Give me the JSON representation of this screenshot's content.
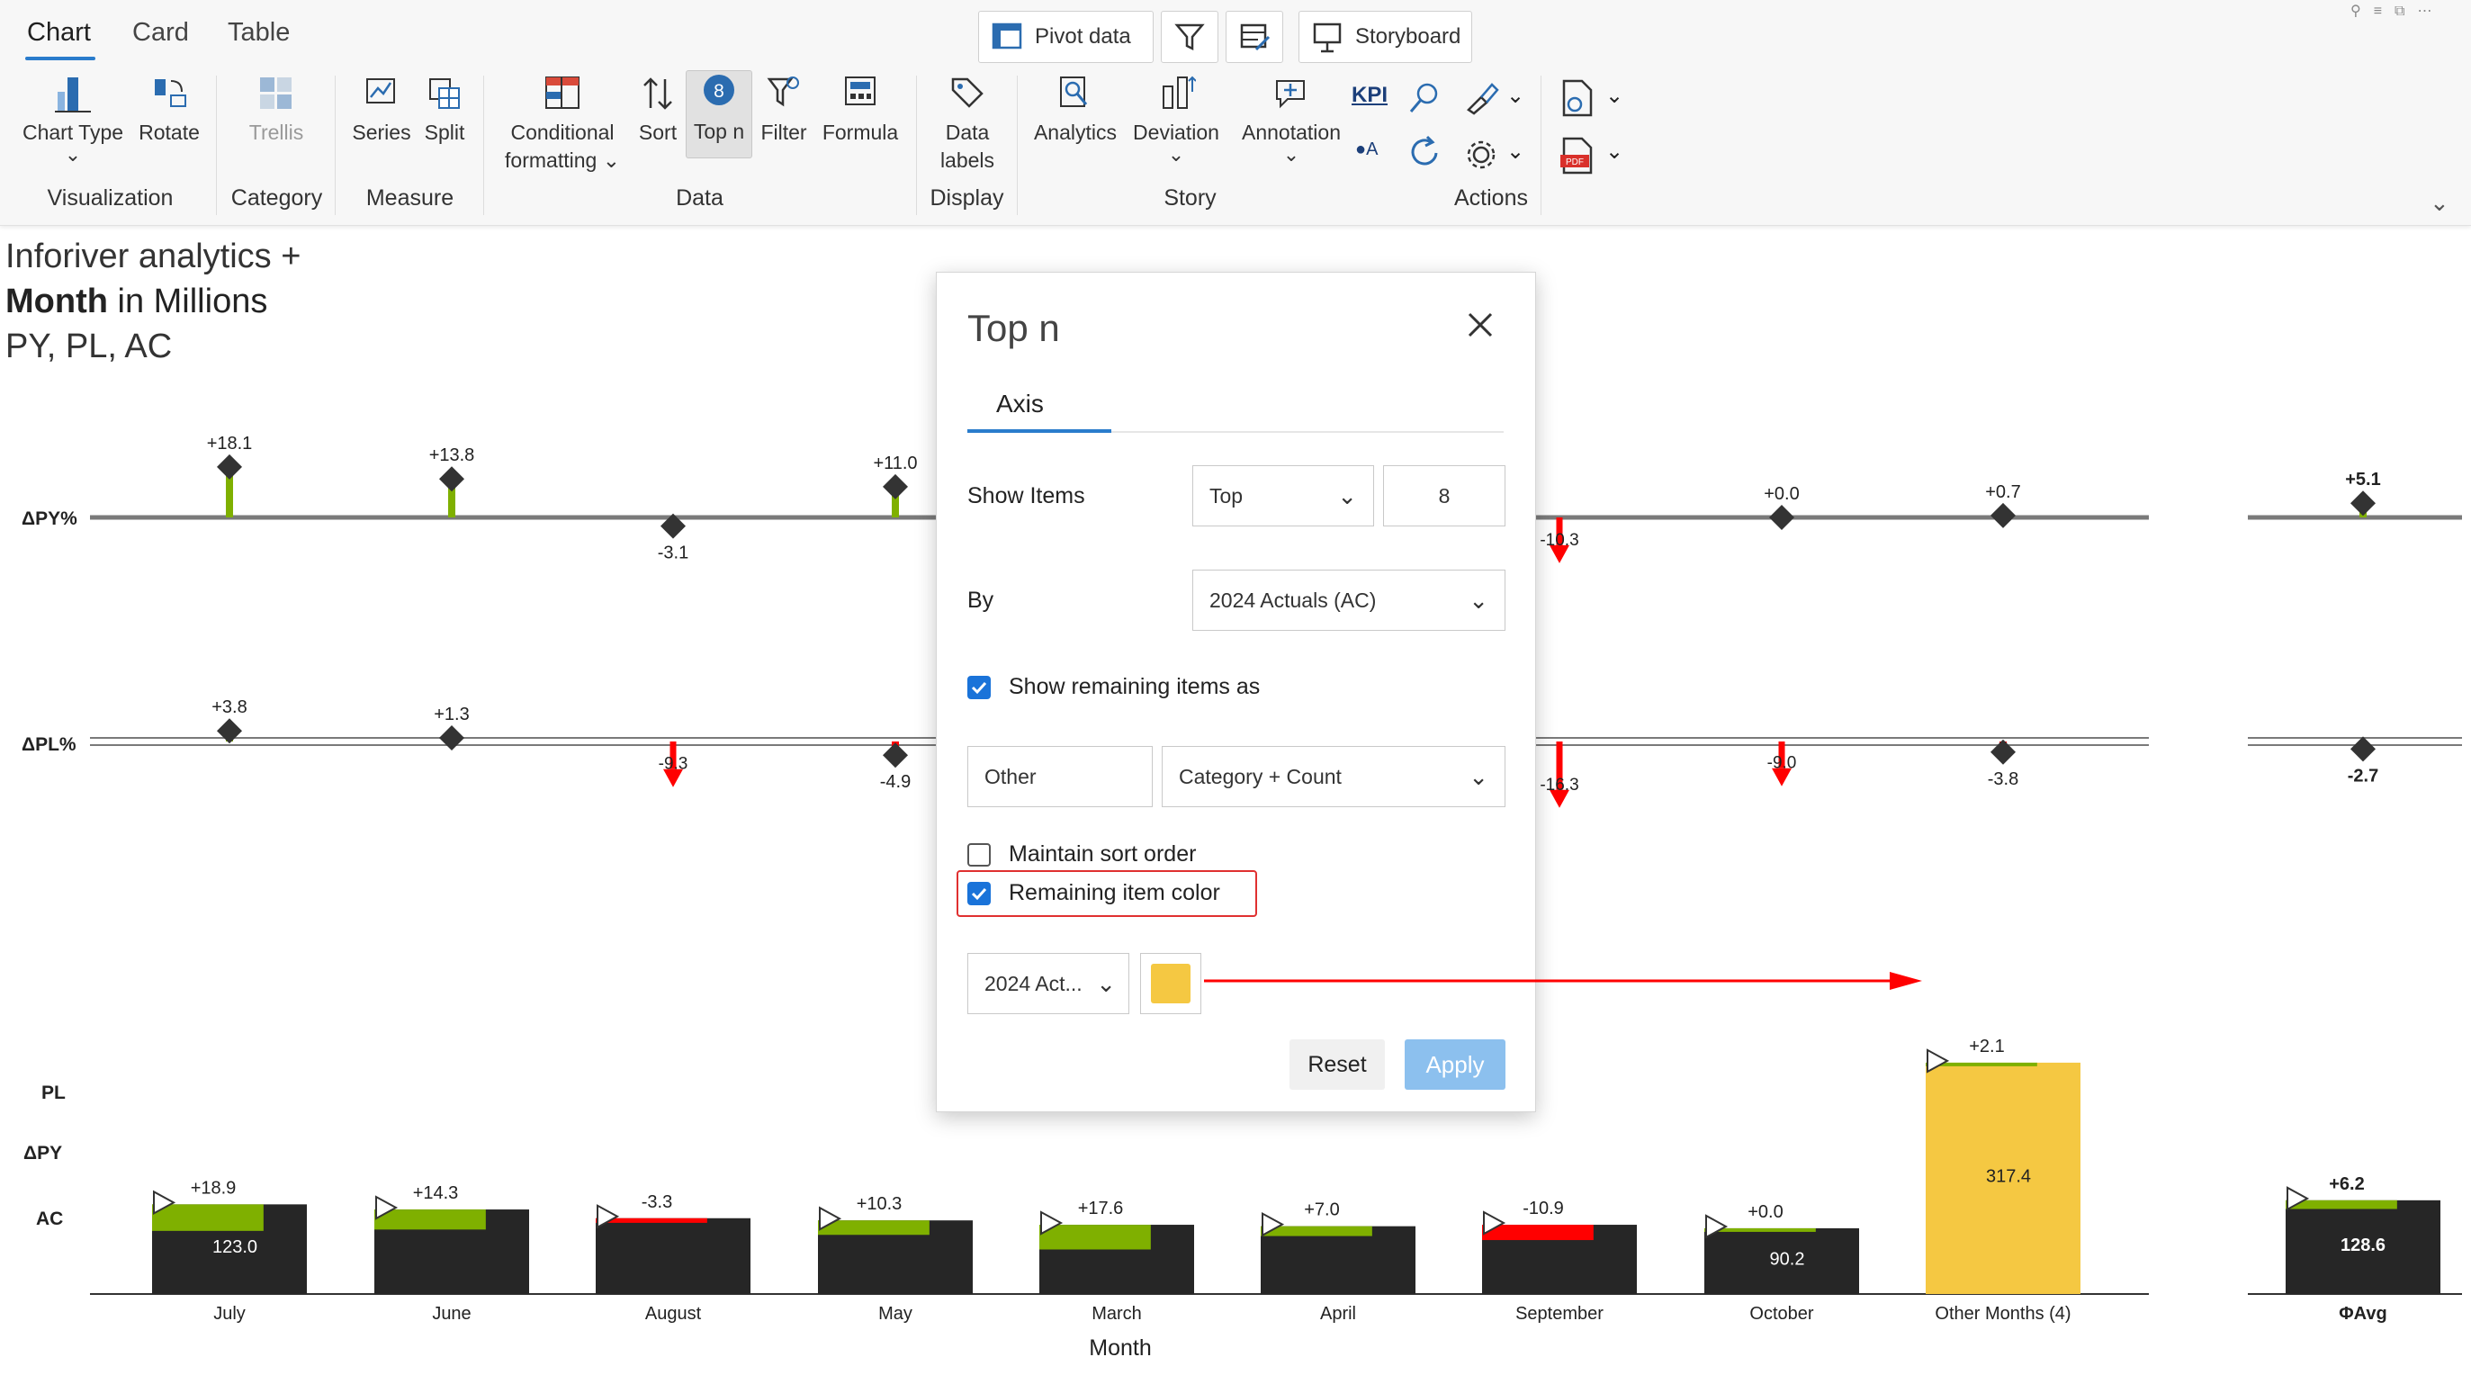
{
  "ribbon": {
    "tabs": [
      "Chart",
      "Card",
      "Table"
    ],
    "active_tab": "Chart",
    "top_buttons": {
      "pivot": "Pivot data",
      "storyboard": "Storyboard"
    },
    "buttons": {
      "chart_type": "Chart Type",
      "rotate": "Rotate",
      "trellis": "Trellis",
      "series": "Series",
      "split": "Split",
      "conditional_1": "Conditional",
      "conditional_2": "formatting",
      "sort": "Sort",
      "top_n": "Top n",
      "top_n_badge": "8",
      "filter": "Filter",
      "formula": "Formula",
      "data_labels_1": "Data",
      "data_labels_2": "labels",
      "analytics": "Analytics",
      "deviation": "Deviation",
      "annotation": "Annotation",
      "kpi": "KPI",
      "kpi_a": "A"
    },
    "groups": {
      "visualization": "Visualization",
      "category": "Category",
      "measure": "Measure",
      "data": "Data",
      "display": "Display",
      "story": "Story",
      "actions": "Actions"
    }
  },
  "chart_title": {
    "line1": "Inforiver analytics +",
    "line2_bold": "Month",
    "line2_rest": " in Millions",
    "line3": "PY, PL, AC"
  },
  "chart_data": {
    "type": "bar",
    "categories": [
      "July",
      "June",
      "August",
      "May",
      "March",
      "April",
      "September",
      "October",
      "Other Months (4)"
    ],
    "series": [
      {
        "name": "AC",
        "values": [
          123.0,
          null,
          null,
          null,
          null,
          null,
          null,
          90.2,
          317.4
        ]
      },
      {
        "name": "ΔPY",
        "values": [
          18.9,
          14.3,
          -3.3,
          10.3,
          17.6,
          7.0,
          -10.9,
          0.0,
          2.1
        ]
      },
      {
        "name": "ΔPY%",
        "values": [
          18.1,
          13.8,
          -3.1,
          11.0,
          null,
          null,
          -10.3,
          0.0,
          0.7
        ]
      },
      {
        "name": "ΔPL%",
        "values": [
          3.8,
          1.3,
          -9.3,
          -4.9,
          null,
          null,
          -16.3,
          -9.0,
          -3.8
        ]
      }
    ],
    "bar_labels": [
      "123.0",
      "",
      "",
      "",
      "",
      "",
      "",
      "90.2",
      "317.4"
    ],
    "dpy_labels": [
      "+18.9",
      "+14.3",
      "-3.3",
      "+10.3",
      "+17.6",
      "+7.0",
      "-10.9",
      "+0.0",
      "+2.1"
    ],
    "dpy_pct_labels": [
      "+18.1",
      "+13.8",
      "-3.1",
      "+11.0",
      "",
      "",
      "-10.3",
      "+0.0",
      "+0.7"
    ],
    "dpl_pct_labels": [
      "+3.8",
      "+1.3",
      "-9.3",
      "-4.9",
      "",
      "",
      "-16.3",
      "-9.0",
      "-3.8"
    ],
    "row_labels": {
      "dpy_pct": "ΔPY%",
      "dpl_pct": "ΔPL%",
      "pl": "PL",
      "dpy": "ΔPY",
      "ac": "AC"
    },
    "xlabel": "Month",
    "avg": {
      "label": "ΦAvg",
      "ac": "128.6",
      "dpy": "+6.2",
      "dpy_pct": "+5.1",
      "dpl_pct": "-2.7"
    },
    "colors": {
      "positive": "#7fb000",
      "negative": "#ff0000",
      "ac": "#262626",
      "remaining": "#f5c842",
      "axis": "#7a7a7a"
    }
  },
  "dialog": {
    "title": "Top n",
    "tab": "Axis",
    "show_items_label": "Show Items",
    "show_items_value": "Top",
    "count_value": "8",
    "by_label": "By",
    "by_value": "2024 Actuals (AC)",
    "show_remaining_label": "Show remaining items as",
    "show_remaining_checked": true,
    "other_value": "Other",
    "category_count_value": "Category + Count",
    "maintain_sort_label": "Maintain sort order",
    "maintain_sort_checked": false,
    "remaining_color_label": "Remaining item color",
    "remaining_color_checked": true,
    "measure_select_value": "2024 Act...",
    "swatch_color": "#f5c842",
    "reset_label": "Reset",
    "apply_label": "Apply"
  }
}
